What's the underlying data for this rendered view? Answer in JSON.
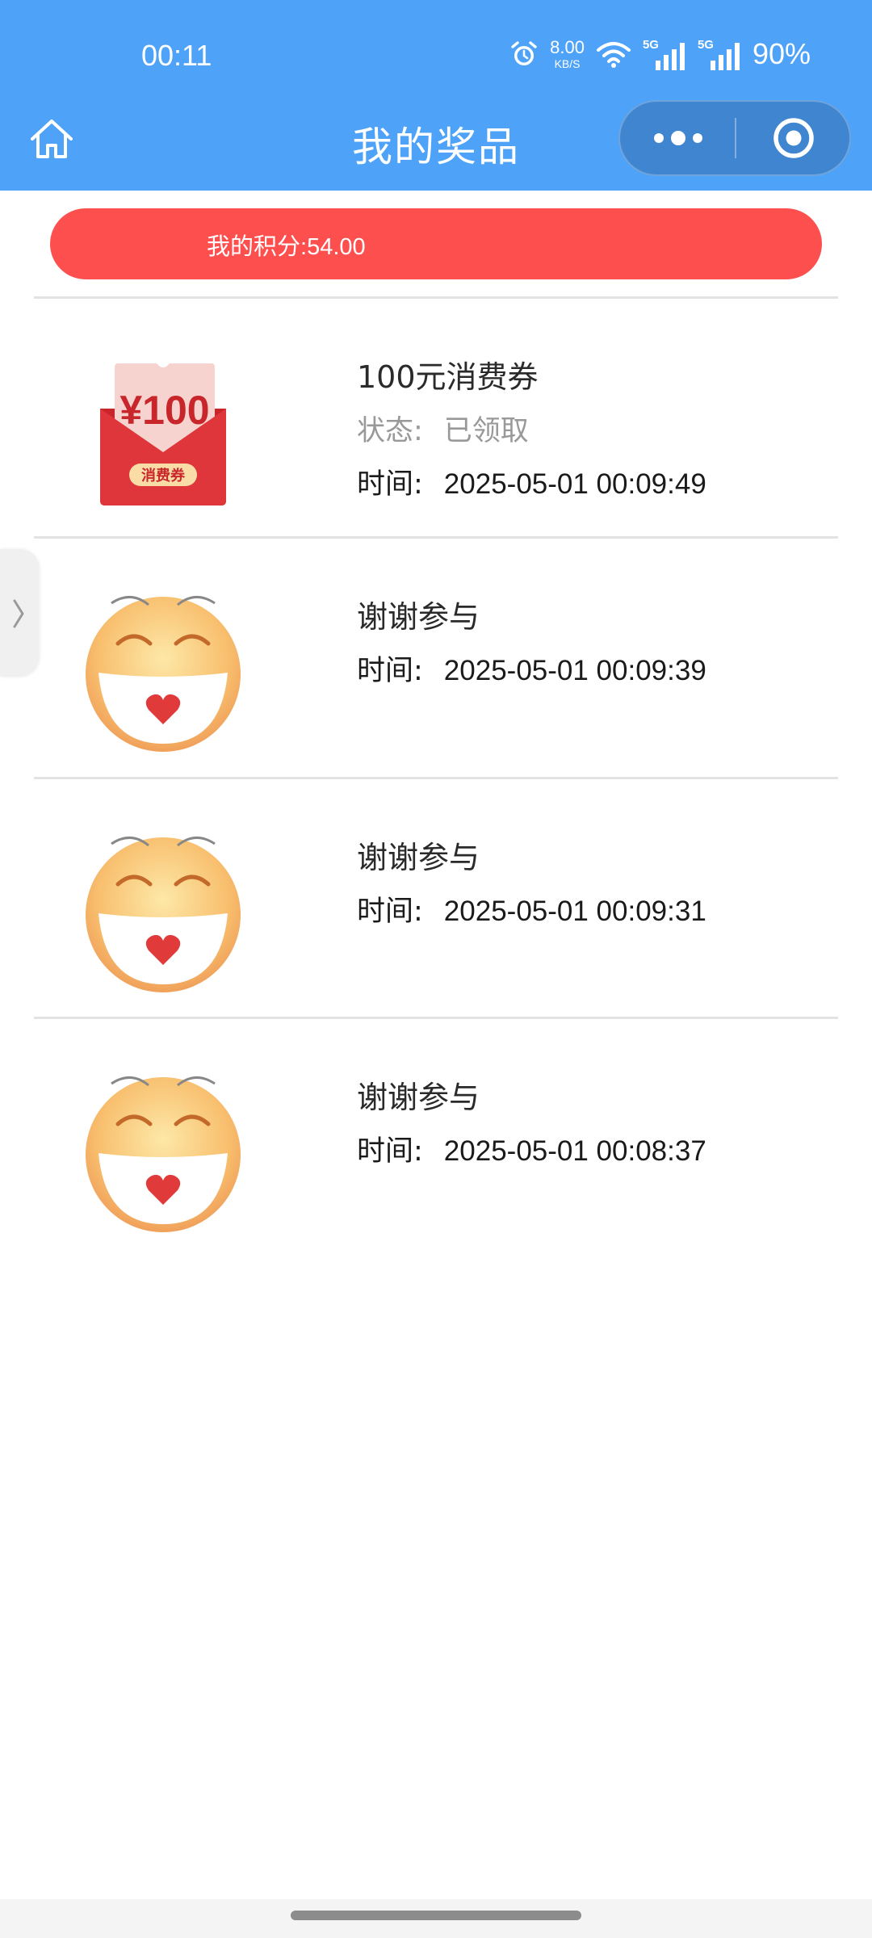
{
  "status_bar": {
    "time": "00:11",
    "net_speed": "8.00",
    "net_speed_unit": "KB/S",
    "sim1": "5G",
    "sim2": "5G",
    "battery": "90%"
  },
  "nav": {
    "title": "我的奖品",
    "icons": [
      "home-icon",
      "more-icon",
      "close-target-icon"
    ]
  },
  "points": {
    "label": "我的积分:",
    "value": "54.00"
  },
  "prizes": [
    {
      "title": "100元消费券",
      "status_label": "状态:",
      "status_value": "已领取",
      "time_label": "时间:",
      "time_value": "2025-05-01 00:09:49",
      "image": "coupon-image",
      "coupon_amount": "¥100",
      "coupon_caption": "消费券"
    },
    {
      "title": "谢谢参与",
      "time_label": "时间:",
      "time_value": "2025-05-01 00:09:39",
      "image": "smiley-image"
    },
    {
      "title": "谢谢参与",
      "time_label": "时间:",
      "time_value": "2025-05-01 00:09:31",
      "image": "smiley-image"
    },
    {
      "title": "谢谢参与",
      "time_label": "时间:",
      "time_value": "2025-05-01 00:08:37",
      "image": "smiley-image"
    }
  ],
  "colors": {
    "header_bg": "#4ea3f9",
    "capsule_bg": "#3f85d0",
    "points_bg": "#fe4f4f",
    "separator": "#e3e3e3",
    "status_gray": "#999999"
  }
}
